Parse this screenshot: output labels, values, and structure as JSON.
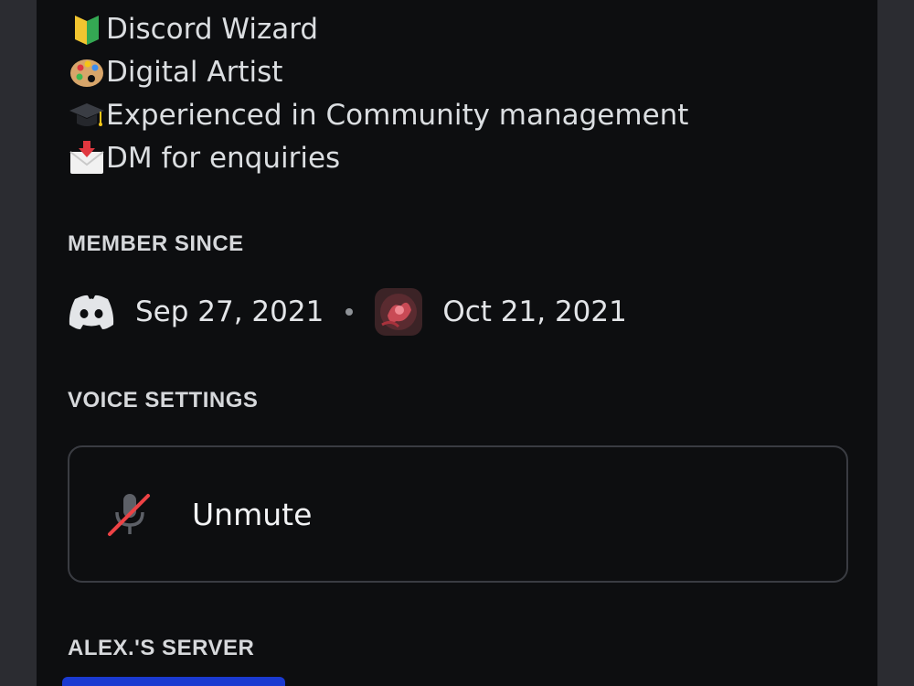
{
  "bio": [
    {
      "icon": "beginner-badge-icon",
      "text": "Discord Wizard"
    },
    {
      "icon": "artist-palette-icon",
      "text": "Digital Artist"
    },
    {
      "icon": "graduation-cap-icon",
      "text": "Experienced in Community management"
    },
    {
      "icon": "incoming-envelope-icon",
      "text": "DM for enquiries"
    }
  ],
  "member_since": {
    "title": "MEMBER SINCE",
    "discord_date": "Sep 27, 2021",
    "server_date": "Oct 21, 2021"
  },
  "voice_settings": {
    "title": "VOICE SETTINGS",
    "unmute_label": "Unmute"
  },
  "server_section": {
    "title": "ALEX.'S SERVER"
  },
  "colors": {
    "background": "#0d0e10",
    "side_gutter": "#2b2c31",
    "mute_red": "#ed4245",
    "accent_blue": "#1a3ad1"
  }
}
